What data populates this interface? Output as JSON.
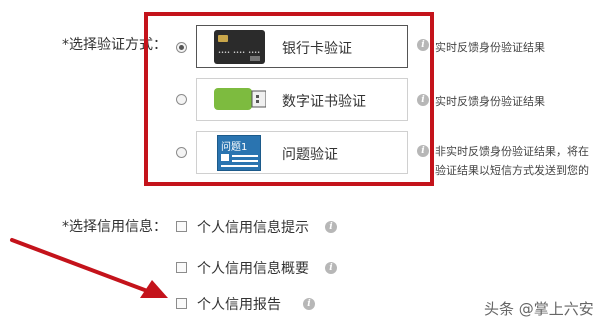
{
  "verify_section": {
    "label": "选择验证方式：",
    "required_mark": "*",
    "options": [
      {
        "label": "银行卡验证",
        "desc": "实时反馈身份验证结果",
        "selected": true
      },
      {
        "label": "数字证书验证",
        "desc": "实时反馈身份验证结果",
        "selected": false
      },
      {
        "label": "问题验证",
        "desc_line1": "非实时反馈身份验证结果，将在",
        "desc_line2": "验证结果以短信方式发送到您的",
        "selected": false,
        "icon_text": "问题1"
      }
    ]
  },
  "credit_section": {
    "label": "选择信用信息：",
    "required_mark": "*",
    "items": [
      {
        "label": "个人信用信息提示",
        "checked": false
      },
      {
        "label": "个人信用信息概要",
        "checked": false
      },
      {
        "label": "个人信用报告",
        "checked": false
      }
    ]
  },
  "watermark": {
    "text": "头条 @掌上六安"
  },
  "colors": {
    "highlight_frame": "#c4131b",
    "arrow": "#c4131b",
    "info_icon": "#b7b7b7"
  }
}
